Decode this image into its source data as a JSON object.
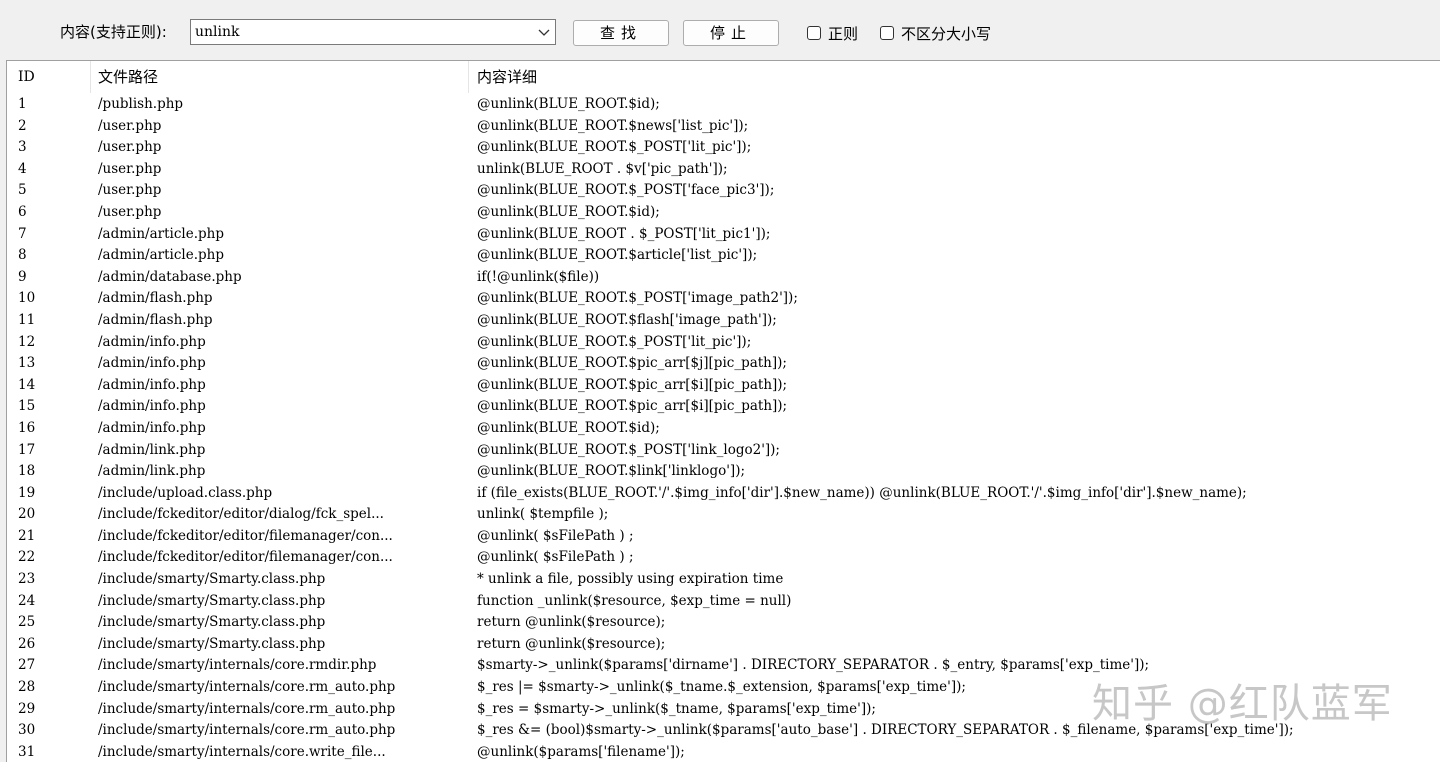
{
  "toolbar": {
    "search_label": "内容(支持正则):",
    "search_value": "unlink",
    "find_button": "查找",
    "stop_button": "停止",
    "regex_checkbox": "正则",
    "case_checkbox": "不区分大小写"
  },
  "table": {
    "columns": [
      "ID",
      "文件路径",
      "内容详细"
    ],
    "rows": [
      {
        "id": "1",
        "path": "/publish.php",
        "detail": "@unlink(BLUE_ROOT.$id);"
      },
      {
        "id": "2",
        "path": "/user.php",
        "detail": "@unlink(BLUE_ROOT.$news['list_pic']);"
      },
      {
        "id": "3",
        "path": "/user.php",
        "detail": "@unlink(BLUE_ROOT.$_POST['lit_pic']);"
      },
      {
        "id": "4",
        "path": "/user.php",
        "detail": "unlink(BLUE_ROOT . $v['pic_path']);"
      },
      {
        "id": "5",
        "path": "/user.php",
        "detail": "@unlink(BLUE_ROOT.$_POST['face_pic3']);"
      },
      {
        "id": "6",
        "path": "/user.php",
        "detail": "@unlink(BLUE_ROOT.$id);"
      },
      {
        "id": "7",
        "path": "/admin/article.php",
        "detail": "@unlink(BLUE_ROOT . $_POST['lit_pic1']);"
      },
      {
        "id": "8",
        "path": "/admin/article.php",
        "detail": "@unlink(BLUE_ROOT.$article['list_pic']);"
      },
      {
        "id": "9",
        "path": "/admin/database.php",
        "detail": "if(!@unlink($file))"
      },
      {
        "id": "10",
        "path": "/admin/flash.php",
        "detail": "@unlink(BLUE_ROOT.$_POST['image_path2']);"
      },
      {
        "id": "11",
        "path": "/admin/flash.php",
        "detail": "@unlink(BLUE_ROOT.$flash['image_path']);"
      },
      {
        "id": "12",
        "path": "/admin/info.php",
        "detail": "@unlink(BLUE_ROOT.$_POST['lit_pic']);"
      },
      {
        "id": "13",
        "path": "/admin/info.php",
        "detail": "@unlink(BLUE_ROOT.$pic_arr[$j][pic_path]);"
      },
      {
        "id": "14",
        "path": "/admin/info.php",
        "detail": "@unlink(BLUE_ROOT.$pic_arr[$i][pic_path]);"
      },
      {
        "id": "15",
        "path": "/admin/info.php",
        "detail": "@unlink(BLUE_ROOT.$pic_arr[$i][pic_path]);"
      },
      {
        "id": "16",
        "path": "/admin/info.php",
        "detail": "@unlink(BLUE_ROOT.$id);"
      },
      {
        "id": "17",
        "path": "/admin/link.php",
        "detail": "@unlink(BLUE_ROOT.$_POST['link_logo2']);"
      },
      {
        "id": "18",
        "path": "/admin/link.php",
        "detail": "@unlink(BLUE_ROOT.$link['linklogo']);"
      },
      {
        "id": "19",
        "path": "/include/upload.class.php",
        "detail": "if (file_exists(BLUE_ROOT.'/'.$img_info['dir'].$new_name)) @unlink(BLUE_ROOT.'/'.$img_info['dir'].$new_name);"
      },
      {
        "id": "20",
        "path": "/include/fckeditor/editor/dialog/fck_spel...",
        "detail": "unlink( $tempfile );"
      },
      {
        "id": "21",
        "path": "/include/fckeditor/editor/filemanager/con...",
        "detail": "@unlink( $sFilePath ) ;"
      },
      {
        "id": "22",
        "path": "/include/fckeditor/editor/filemanager/con...",
        "detail": "@unlink( $sFilePath ) ;"
      },
      {
        "id": "23",
        "path": "/include/smarty/Smarty.class.php",
        "detail": "* unlink a file, possibly using expiration time"
      },
      {
        "id": "24",
        "path": "/include/smarty/Smarty.class.php",
        "detail": "function _unlink($resource, $exp_time = null)"
      },
      {
        "id": "25",
        "path": "/include/smarty/Smarty.class.php",
        "detail": "return @unlink($resource);"
      },
      {
        "id": "26",
        "path": "/include/smarty/Smarty.class.php",
        "detail": "return @unlink($resource);"
      },
      {
        "id": "27",
        "path": "/include/smarty/internals/core.rmdir.php",
        "detail": "$smarty->_unlink($params['dirname'] . DIRECTORY_SEPARATOR . $_entry, $params['exp_time']);"
      },
      {
        "id": "28",
        "path": "/include/smarty/internals/core.rm_auto.php",
        "detail": "$_res |= $smarty->_unlink($_tname.$_extension, $params['exp_time']);"
      },
      {
        "id": "29",
        "path": "/include/smarty/internals/core.rm_auto.php",
        "detail": "$_res = $smarty->_unlink($_tname, $params['exp_time']);"
      },
      {
        "id": "30",
        "path": "/include/smarty/internals/core.rm_auto.php",
        "detail": "$_res &= (bool)$smarty->_unlink($params['auto_base'] . DIRECTORY_SEPARATOR . $_filename, $params['exp_time']);"
      },
      {
        "id": "31",
        "path": "/include/smarty/internals/core.write_file...",
        "detail": "@unlink($params['filename']);"
      }
    ]
  },
  "watermark": "知乎 @红队蓝军"
}
